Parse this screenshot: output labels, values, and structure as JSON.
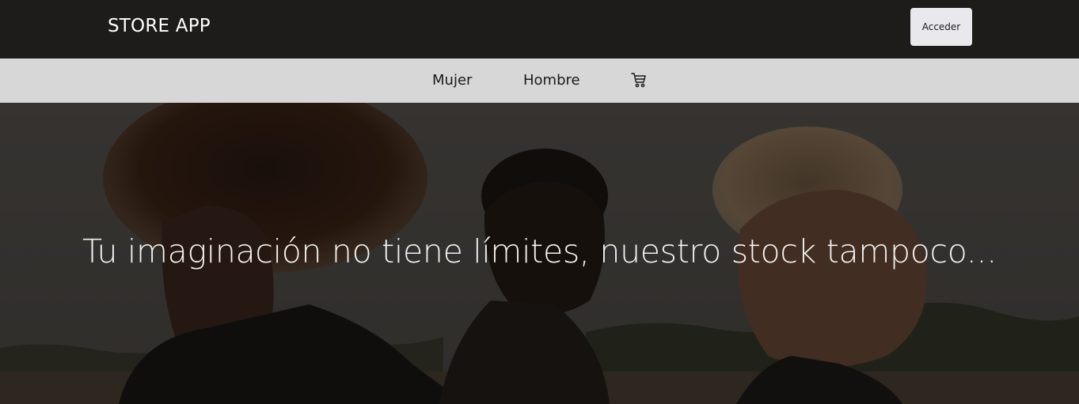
{
  "header": {
    "brand": "STORE APP",
    "login_label": "Acceder"
  },
  "nav": {
    "items": [
      {
        "label": "Mujer"
      },
      {
        "label": "Hombre"
      }
    ],
    "cart_icon": "shopping-cart-icon"
  },
  "hero": {
    "headline": "Tu imaginación no tiene límites, nuestro stock tampoco..."
  }
}
